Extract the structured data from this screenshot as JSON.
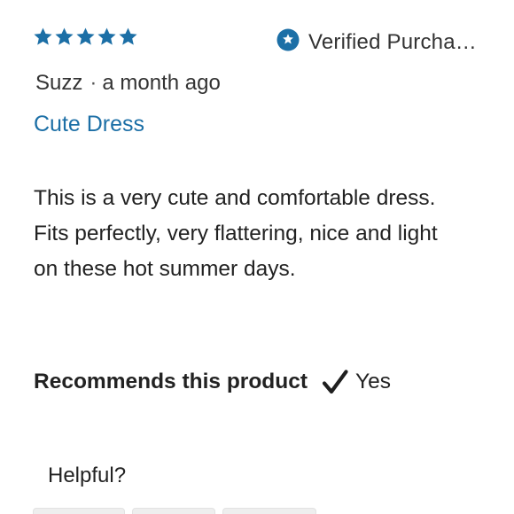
{
  "review": {
    "rating": 5,
    "max_rating": 5,
    "star_color": "#1c6fa6",
    "verified_icon": "star-badge-icon",
    "verified_label": "Verified Purcha…",
    "author": "Suzz",
    "separator": "·",
    "time_ago": "a month ago",
    "title": "Cute Dress",
    "body": "This is a very cute and comfortable dress. Fits perfectly, very flattering, nice and light on these hot summer days.",
    "recommends_label": "Recommends this product",
    "recommends_icon": "checkmark-icon",
    "recommends_value": "Yes",
    "helpful_label": "Helpful?"
  },
  "colors": {
    "accent": "#1c6fa6",
    "text": "#222222"
  }
}
